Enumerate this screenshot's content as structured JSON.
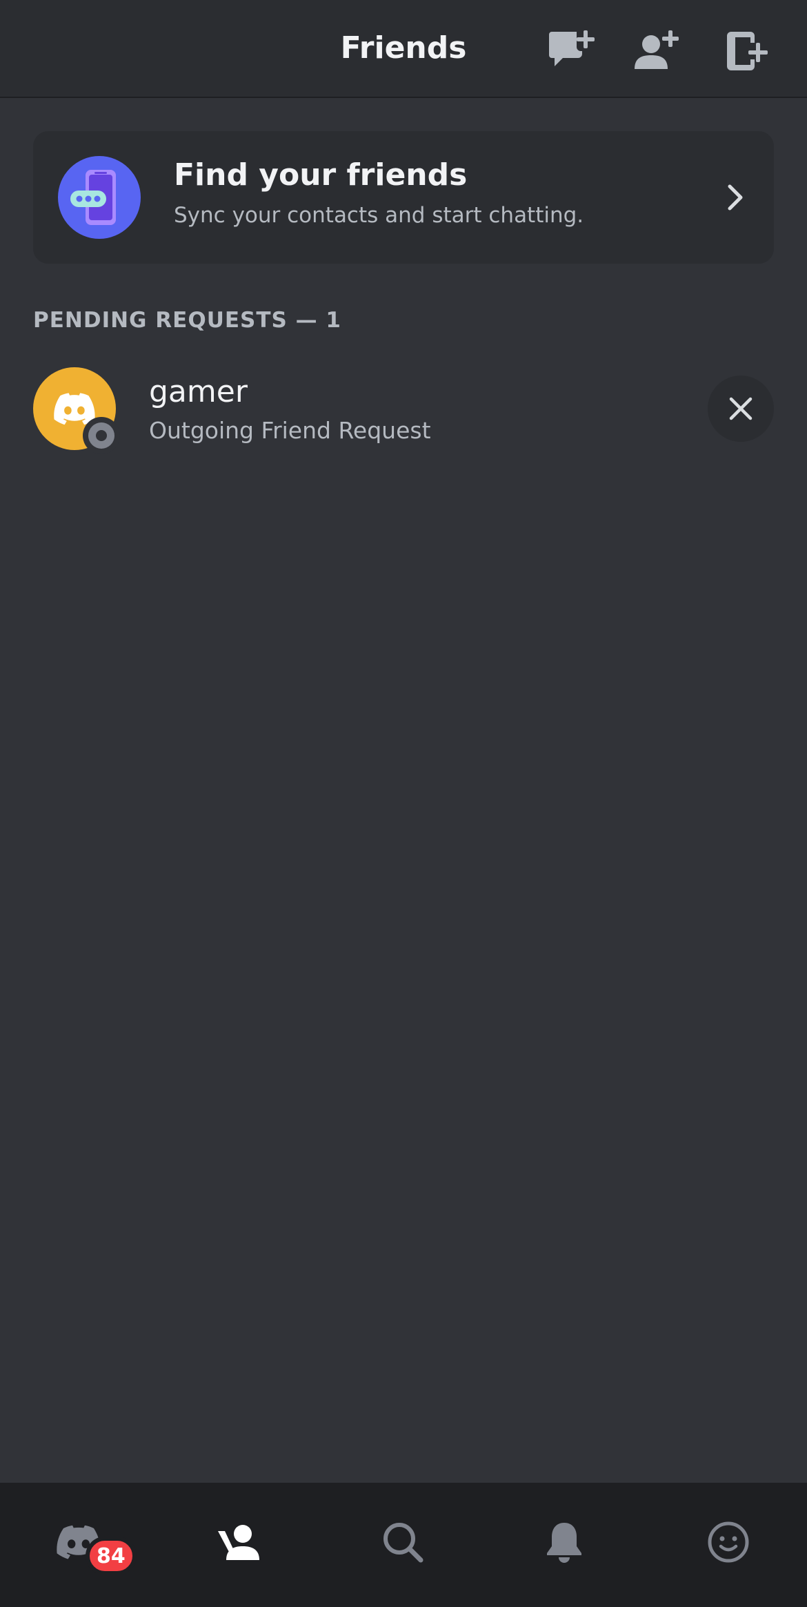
{
  "header": {
    "title": "Friends",
    "icons": [
      "new-message-icon",
      "add-friend-icon",
      "add-contact-device-icon"
    ]
  },
  "find_card": {
    "title": "Find your friends",
    "subtitle": "Sync your contacts and start chatting."
  },
  "pending": {
    "section_label": "PENDING REQUESTS — 1",
    "requests": [
      {
        "name": "gamer",
        "status": "Outgoing Friend Request",
        "avatar_color": "#f0b132",
        "presence": "offline"
      }
    ]
  },
  "bottom_nav": {
    "badge_count": "84",
    "items": [
      "home",
      "friends",
      "search",
      "notifications",
      "profile"
    ],
    "active": "friends"
  },
  "colors": {
    "background": "#313338",
    "header": "#2b2d31",
    "nav": "#1e1f22",
    "blurple": "#5865f2",
    "badge_red": "#f23f43",
    "muted_text": "#b5bac1"
  }
}
